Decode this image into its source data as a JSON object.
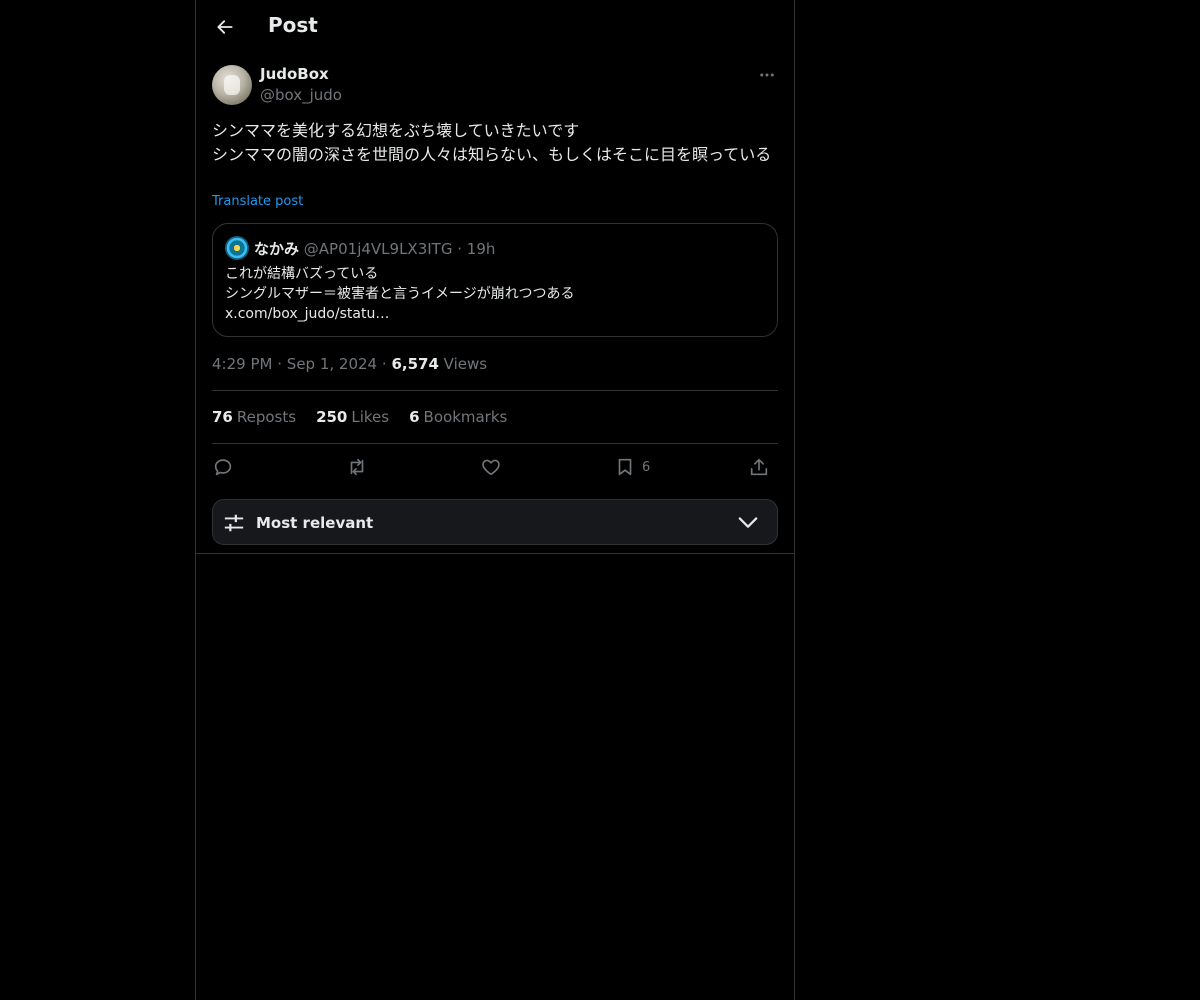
{
  "header": {
    "title": "Post"
  },
  "post": {
    "author": {
      "display_name": "JudoBox",
      "handle": "@box_judo"
    },
    "text": "シンママを美化する幻想をぶち壊していきたいです\nシンママの闇の深さを世間の人々は知らない、もしくはそこに目を瞑っている",
    "translate_label": "Translate post",
    "quote": {
      "display_name": "なかみ",
      "handle": "@AP01j4VL9LX3ITG",
      "separator": "·",
      "time": "19h",
      "text": "これが結構バズっている\nシングルマザー＝被害者と言うイメージが崩れつつある\nx.com/box_judo/statu…"
    },
    "meta": {
      "time": "4:29 PM",
      "sep1": "·",
      "date": "Sep 1, 2024",
      "sep2": "·",
      "views_count": "6,574",
      "views_label": "Views"
    },
    "stats": [
      {
        "count": "76",
        "label": "Reposts"
      },
      {
        "count": "250",
        "label": "Likes"
      },
      {
        "count": "6",
        "label": "Bookmarks"
      }
    ],
    "actions": {
      "reply": {
        "icon": "reply-icon"
      },
      "repost": {
        "icon": "repost-icon"
      },
      "like": {
        "icon": "heart-icon"
      },
      "bookmark": {
        "icon": "bookmark-icon",
        "count": "6"
      },
      "share": {
        "icon": "share-icon"
      }
    }
  },
  "sort": {
    "label": "Most relevant",
    "icon": "sliders-icon"
  },
  "colors": {
    "background": "#000000",
    "text": "#e7e9ea",
    "muted": "#71767b",
    "accent": "#1d9bf0",
    "border": "#2f3336"
  }
}
